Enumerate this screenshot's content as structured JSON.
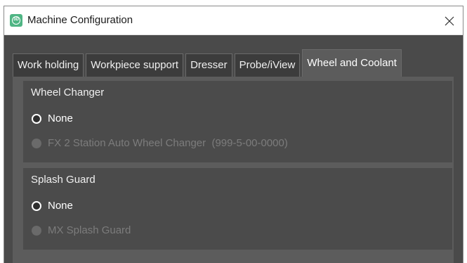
{
  "window": {
    "title": "Machine Configuration",
    "app_icon": "app-logo-icon",
    "close_icon": "close-icon"
  },
  "tabs": [
    {
      "label": "Work holding",
      "active": false
    },
    {
      "label": "Workpiece support",
      "active": false
    },
    {
      "label": "Dresser",
      "active": false
    },
    {
      "label": "Probe/iView",
      "active": false
    },
    {
      "label": "Wheel and Coolant",
      "active": true
    }
  ],
  "groups": [
    {
      "title": "Wheel Changer",
      "options": [
        {
          "label": "None",
          "selected": true,
          "enabled": true
        },
        {
          "label": "FX 2 Station Auto Wheel Changer  (999-5-00-0000)",
          "selected": false,
          "enabled": false
        }
      ]
    },
    {
      "title": "Splash Guard",
      "options": [
        {
          "label": "None",
          "selected": true,
          "enabled": true
        },
        {
          "label": "MX Splash Guard",
          "selected": false,
          "enabled": false
        }
      ]
    }
  ],
  "colors": {
    "window_bg": "#4a4a4a",
    "tab_inactive": "#3c3c3c",
    "panel_bg": "#5c5c5c",
    "group_bg": "#4b4b4b",
    "app_icon_green": "#4fb584",
    "disabled_text": "#7c7c7c"
  }
}
